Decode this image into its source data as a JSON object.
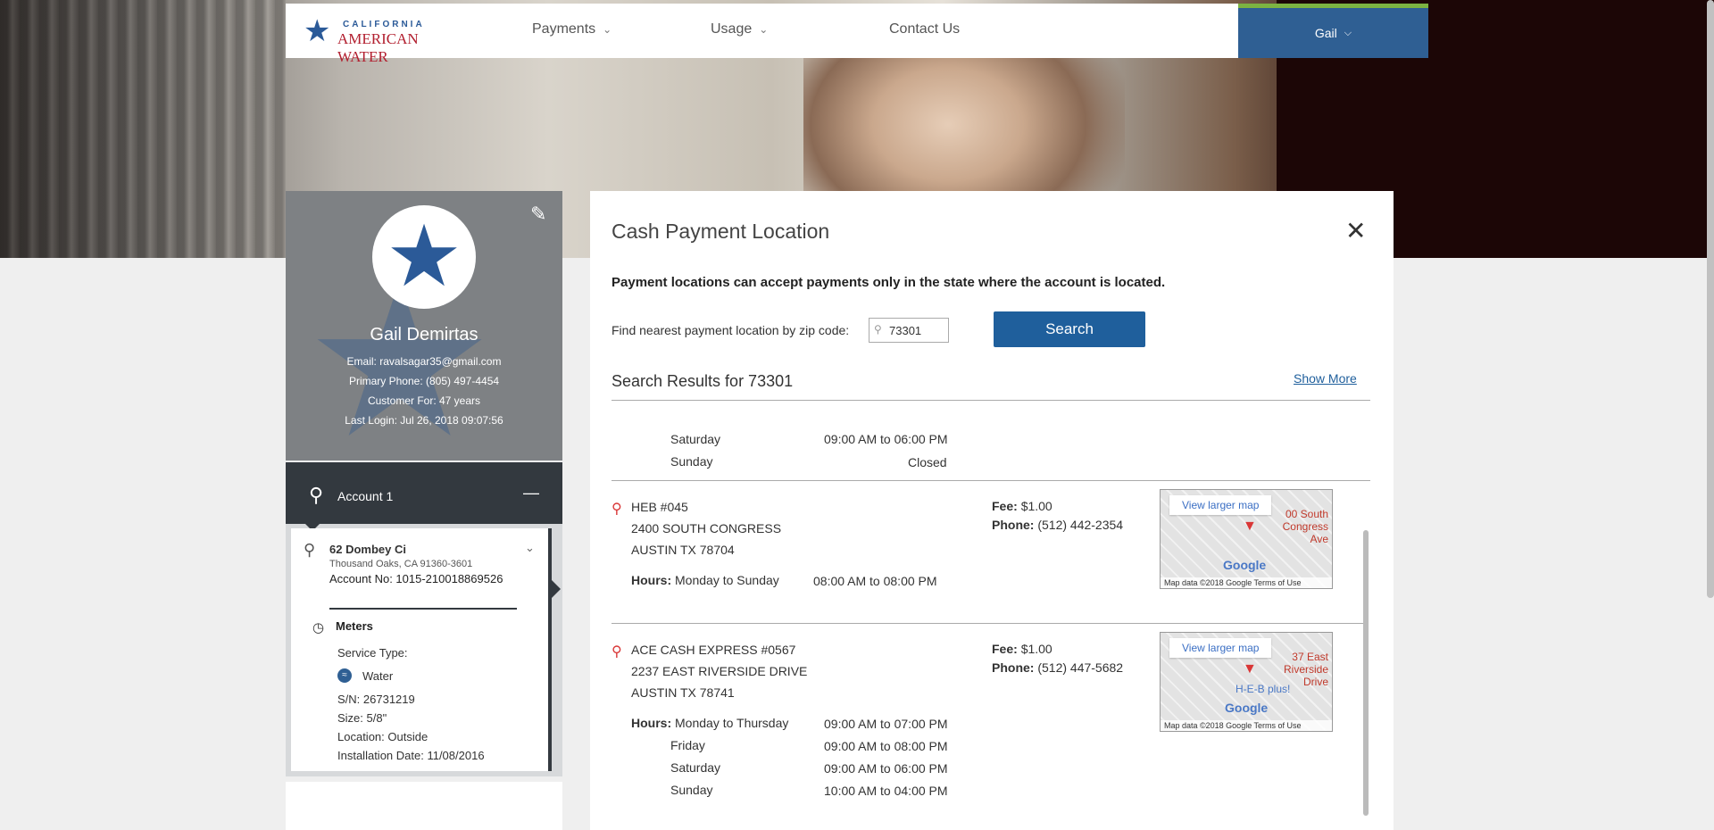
{
  "nav": {
    "logo_top": "CALIFORNIA",
    "logo_bottom": "AMERICAN WATER",
    "items": [
      {
        "label": "Payments"
      },
      {
        "label": "Usage"
      },
      {
        "label": "Contact Us"
      }
    ],
    "user": "Gail"
  },
  "profile": {
    "name": "Gail Demirtas",
    "email": "Email: ravalsagar35@gmail.com",
    "phone": "Primary Phone: (805) 497-4454",
    "customer_for": "Customer For: 47 years",
    "last_login": "Last Login: Jul 26, 2018 09:07:56"
  },
  "account": {
    "title": "Account 1",
    "street": "62 Dombey Ci",
    "city": "Thousand Oaks, CA 91360-3601",
    "number": "Account No: 1015-210018869526",
    "meters_title": "Meters",
    "service_type": "Service Type:",
    "service": "Water",
    "serial": "S/N: 26731219",
    "size": "Size: 5/8\"",
    "location": "Location: Outside",
    "install": "Installation Date: 11/08/2016"
  },
  "modal": {
    "title": "Cash Payment Location",
    "notice": "Payment locations can accept payments only in the state where the account is located.",
    "zip_label": "Find nearest payment location by zip code:",
    "zip_value": "73301",
    "search_label": "Search",
    "results_title": "Search Results for 73301",
    "show_more": "Show More",
    "prev_hours": [
      {
        "day": "Saturday",
        "time": "09:00 AM to 06:00 PM"
      },
      {
        "day": "Sunday",
        "time": "Closed"
      }
    ],
    "locations": [
      {
        "name": "HEB #045",
        "address1": "2400 SOUTH CONGRESS",
        "address2": "AUSTIN TX 78704",
        "fee_label": "Fee:",
        "fee": "$1.00",
        "phone_label": "Phone:",
        "phone": "(512) 442-2354",
        "hours_label": "Hours:",
        "hours": [
          {
            "day": "Monday to Sunday",
            "time": "08:00 AM to 08:00 PM"
          }
        ],
        "map_link": "View larger map",
        "map_street": "00 South Congress Ave",
        "map_footer": "Map data ©2018 Google   Terms of Use"
      },
      {
        "name": "ACE CASH EXPRESS #0567",
        "address1": "2237 EAST RIVERSIDE DRIVE",
        "address2": "AUSTIN TX 78741",
        "fee_label": "Fee:",
        "fee": "$1.00",
        "phone_label": "Phone:",
        "phone": "(512) 447-5682",
        "hours_label": "Hours:",
        "hours": [
          {
            "day": "Monday to Thursday",
            "time": "09:00 AM to 07:00 PM"
          },
          {
            "day": "Friday",
            "time": "09:00 AM to 08:00 PM"
          },
          {
            "day": "Saturday",
            "time": "09:00 AM to 06:00 PM"
          },
          {
            "day": "Sunday",
            "time": "10:00 AM to 04:00 PM"
          }
        ],
        "map_link": "View larger map",
        "map_street": "37 East Riverside Drive",
        "map_extra": "H-E-B plus!",
        "map_footer": "Map data ©2018 Google   Terms of Use"
      }
    ]
  },
  "colors": {
    "brand_blue": "#2f5f93",
    "button_blue": "#1f5f9c",
    "dark": "#33393f"
  }
}
